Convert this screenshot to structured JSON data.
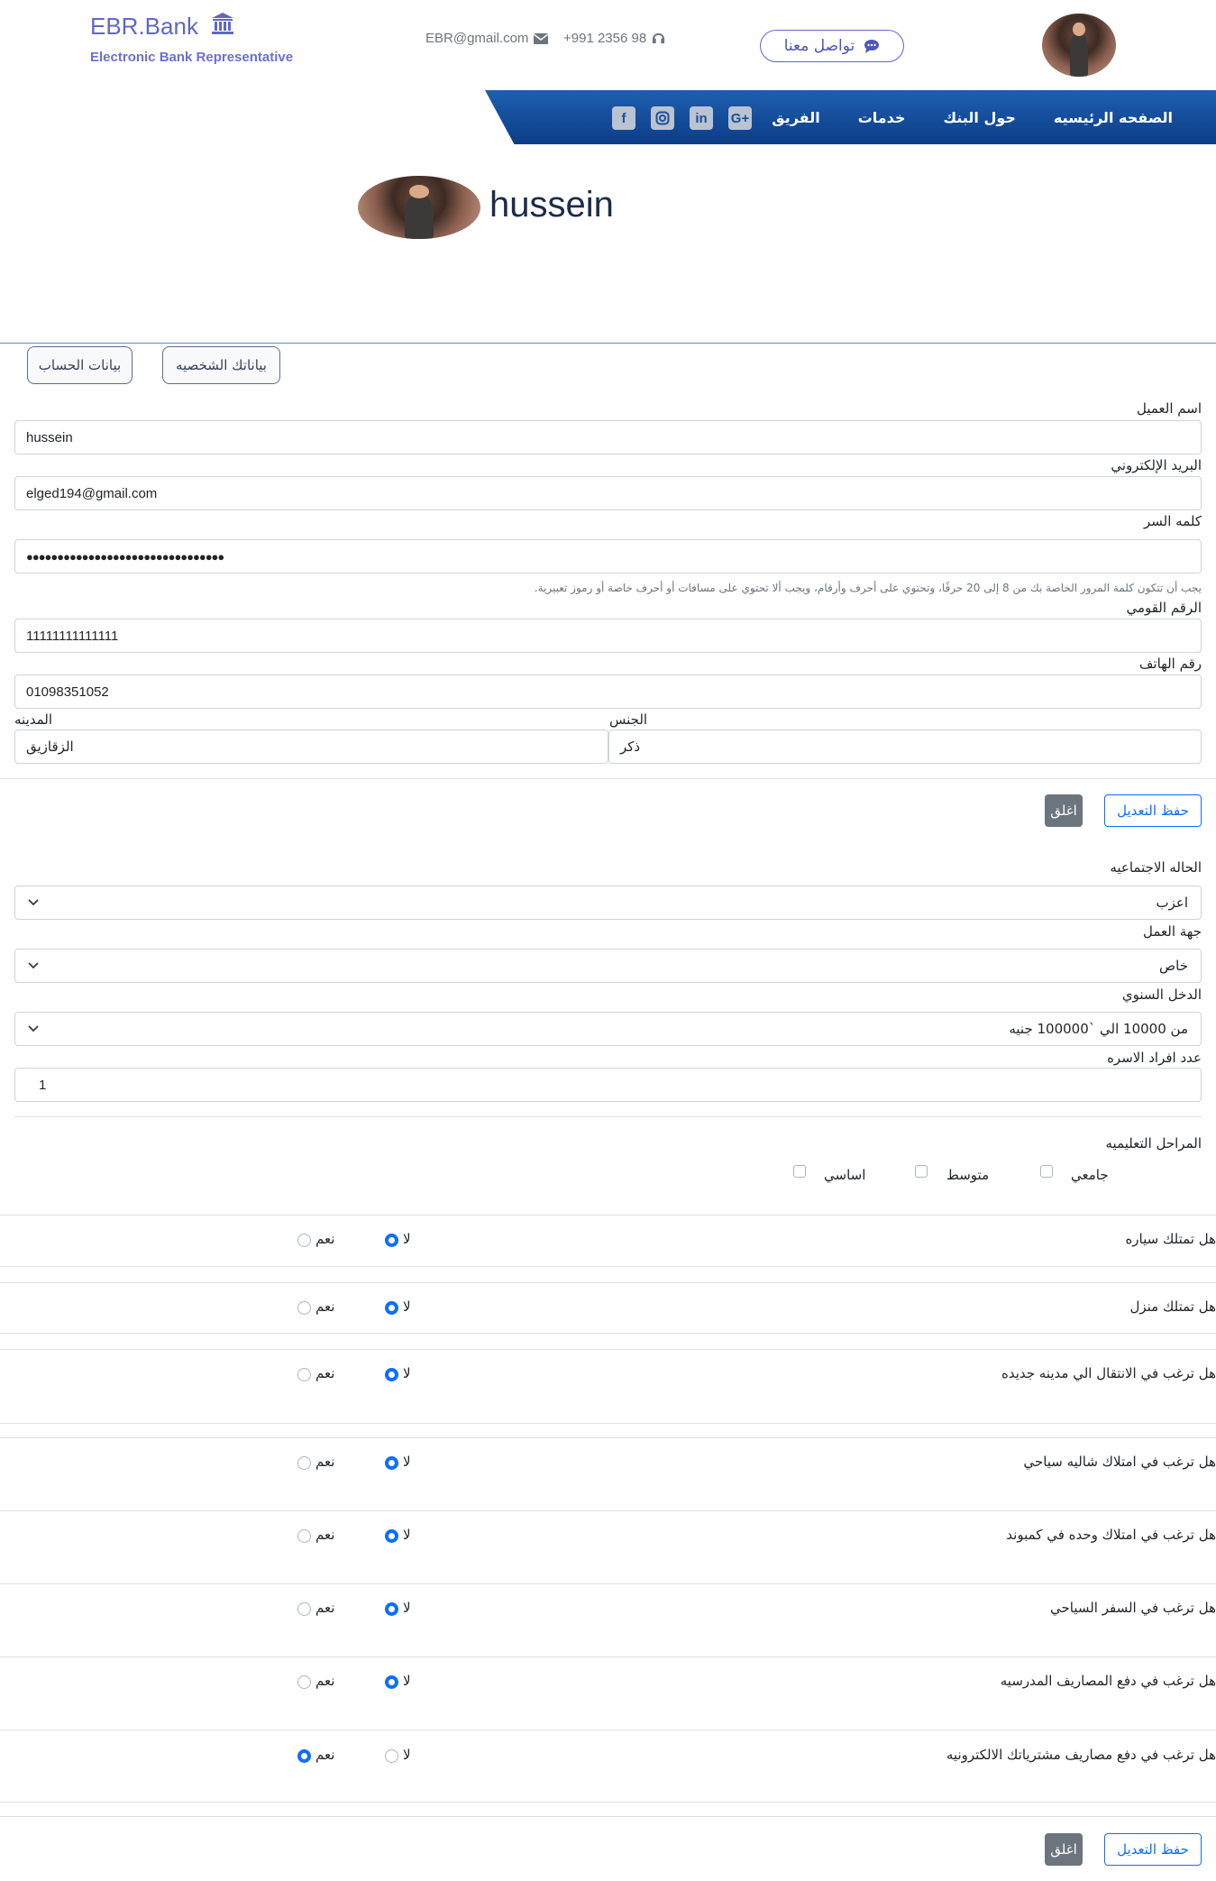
{
  "header": {
    "brand": "EBR.Bank",
    "tagline": "Electronic Bank Representative",
    "email": "EBR@gmail.com",
    "phone": "+991 2356 98",
    "contact_button": "تواصل معنا"
  },
  "nav": {
    "items": [
      "الصفحه الرئيسيه",
      "حول البنك",
      "خدمات",
      "الفريق"
    ],
    "social": [
      "G+",
      "in",
      "instagram",
      "f"
    ]
  },
  "profile": {
    "name": "hussein"
  },
  "tabs": {
    "personal": "بياناتك الشخصيه",
    "account": "بيانات الحساب"
  },
  "personal_form": {
    "name_label": "اسم العميل",
    "name_value": "hussein",
    "email_label": "البريد الإلكتروني",
    "email_value": "elged194@gmail.com",
    "password_label": "كلمه السر",
    "password_value": "●●●●●●●●●●●●●●●●●●●●●●●●●●●●●●●●",
    "password_hint": "يجب أن تتكون كلمة المرور الخاصة بك من 8 إلى 20 حرفًا، وتحتوي على أحرف وأرقام، ويجب ألا تحتوي على مسافات أو أحرف خاصة أو رموز تعبيرية.",
    "national_id_label": "الرقم القومي",
    "national_id_value": "11111111111111",
    "phone_label": "رقم الهاتف",
    "phone_value": "01098351052",
    "gender_label": "الجنس",
    "gender_value": "ذكر",
    "city_label": "المدينه",
    "city_value": "الزقازيق"
  },
  "buttons": {
    "save": "حفظ التعديل",
    "close": "اغلق"
  },
  "account_form": {
    "marital_label": "الحاله الاجتماعيه",
    "marital_value": "اعزب",
    "employer_label": "جهة العمل",
    "employer_value": "خاص",
    "income_label": "الدخل السنوي",
    "income_value": "من 10000 الي `100000 جنيه",
    "family_label": "عدد افراد الاسره",
    "family_value": "1",
    "education_label": "المراحل التعليميه",
    "education_options": [
      "جامعي",
      "متوسط",
      "اساسي"
    ]
  },
  "questions": {
    "yes": "نعم",
    "no": "لا",
    "items": [
      {
        "text": "هل تمتلك سياره",
        "answer": "no"
      },
      {
        "text": "هل تمتلك منزل",
        "answer": "no"
      },
      {
        "text": "هل ترغب في الانتقال الي مدينه جديده",
        "answer": "no"
      },
      {
        "text": "هل ترغب في امتلاك شاليه سياحي",
        "answer": "no"
      },
      {
        "text": "هل ترغب في امتلاك وحده في كمبوند",
        "answer": "no"
      },
      {
        "text": "هل ترغب في السفر السياحي",
        "answer": "no"
      },
      {
        "text": "هل ترغب في دفع المصاريف المدرسيه",
        "answer": "no"
      },
      {
        "text": "هل ترغب في دفع مصاريف مشترياتك الالكترونيه",
        "answer": "yes"
      }
    ]
  },
  "colors": {
    "brand": "#5f67c9",
    "nav": "#0c3d87",
    "primary": "#0d6efd"
  }
}
